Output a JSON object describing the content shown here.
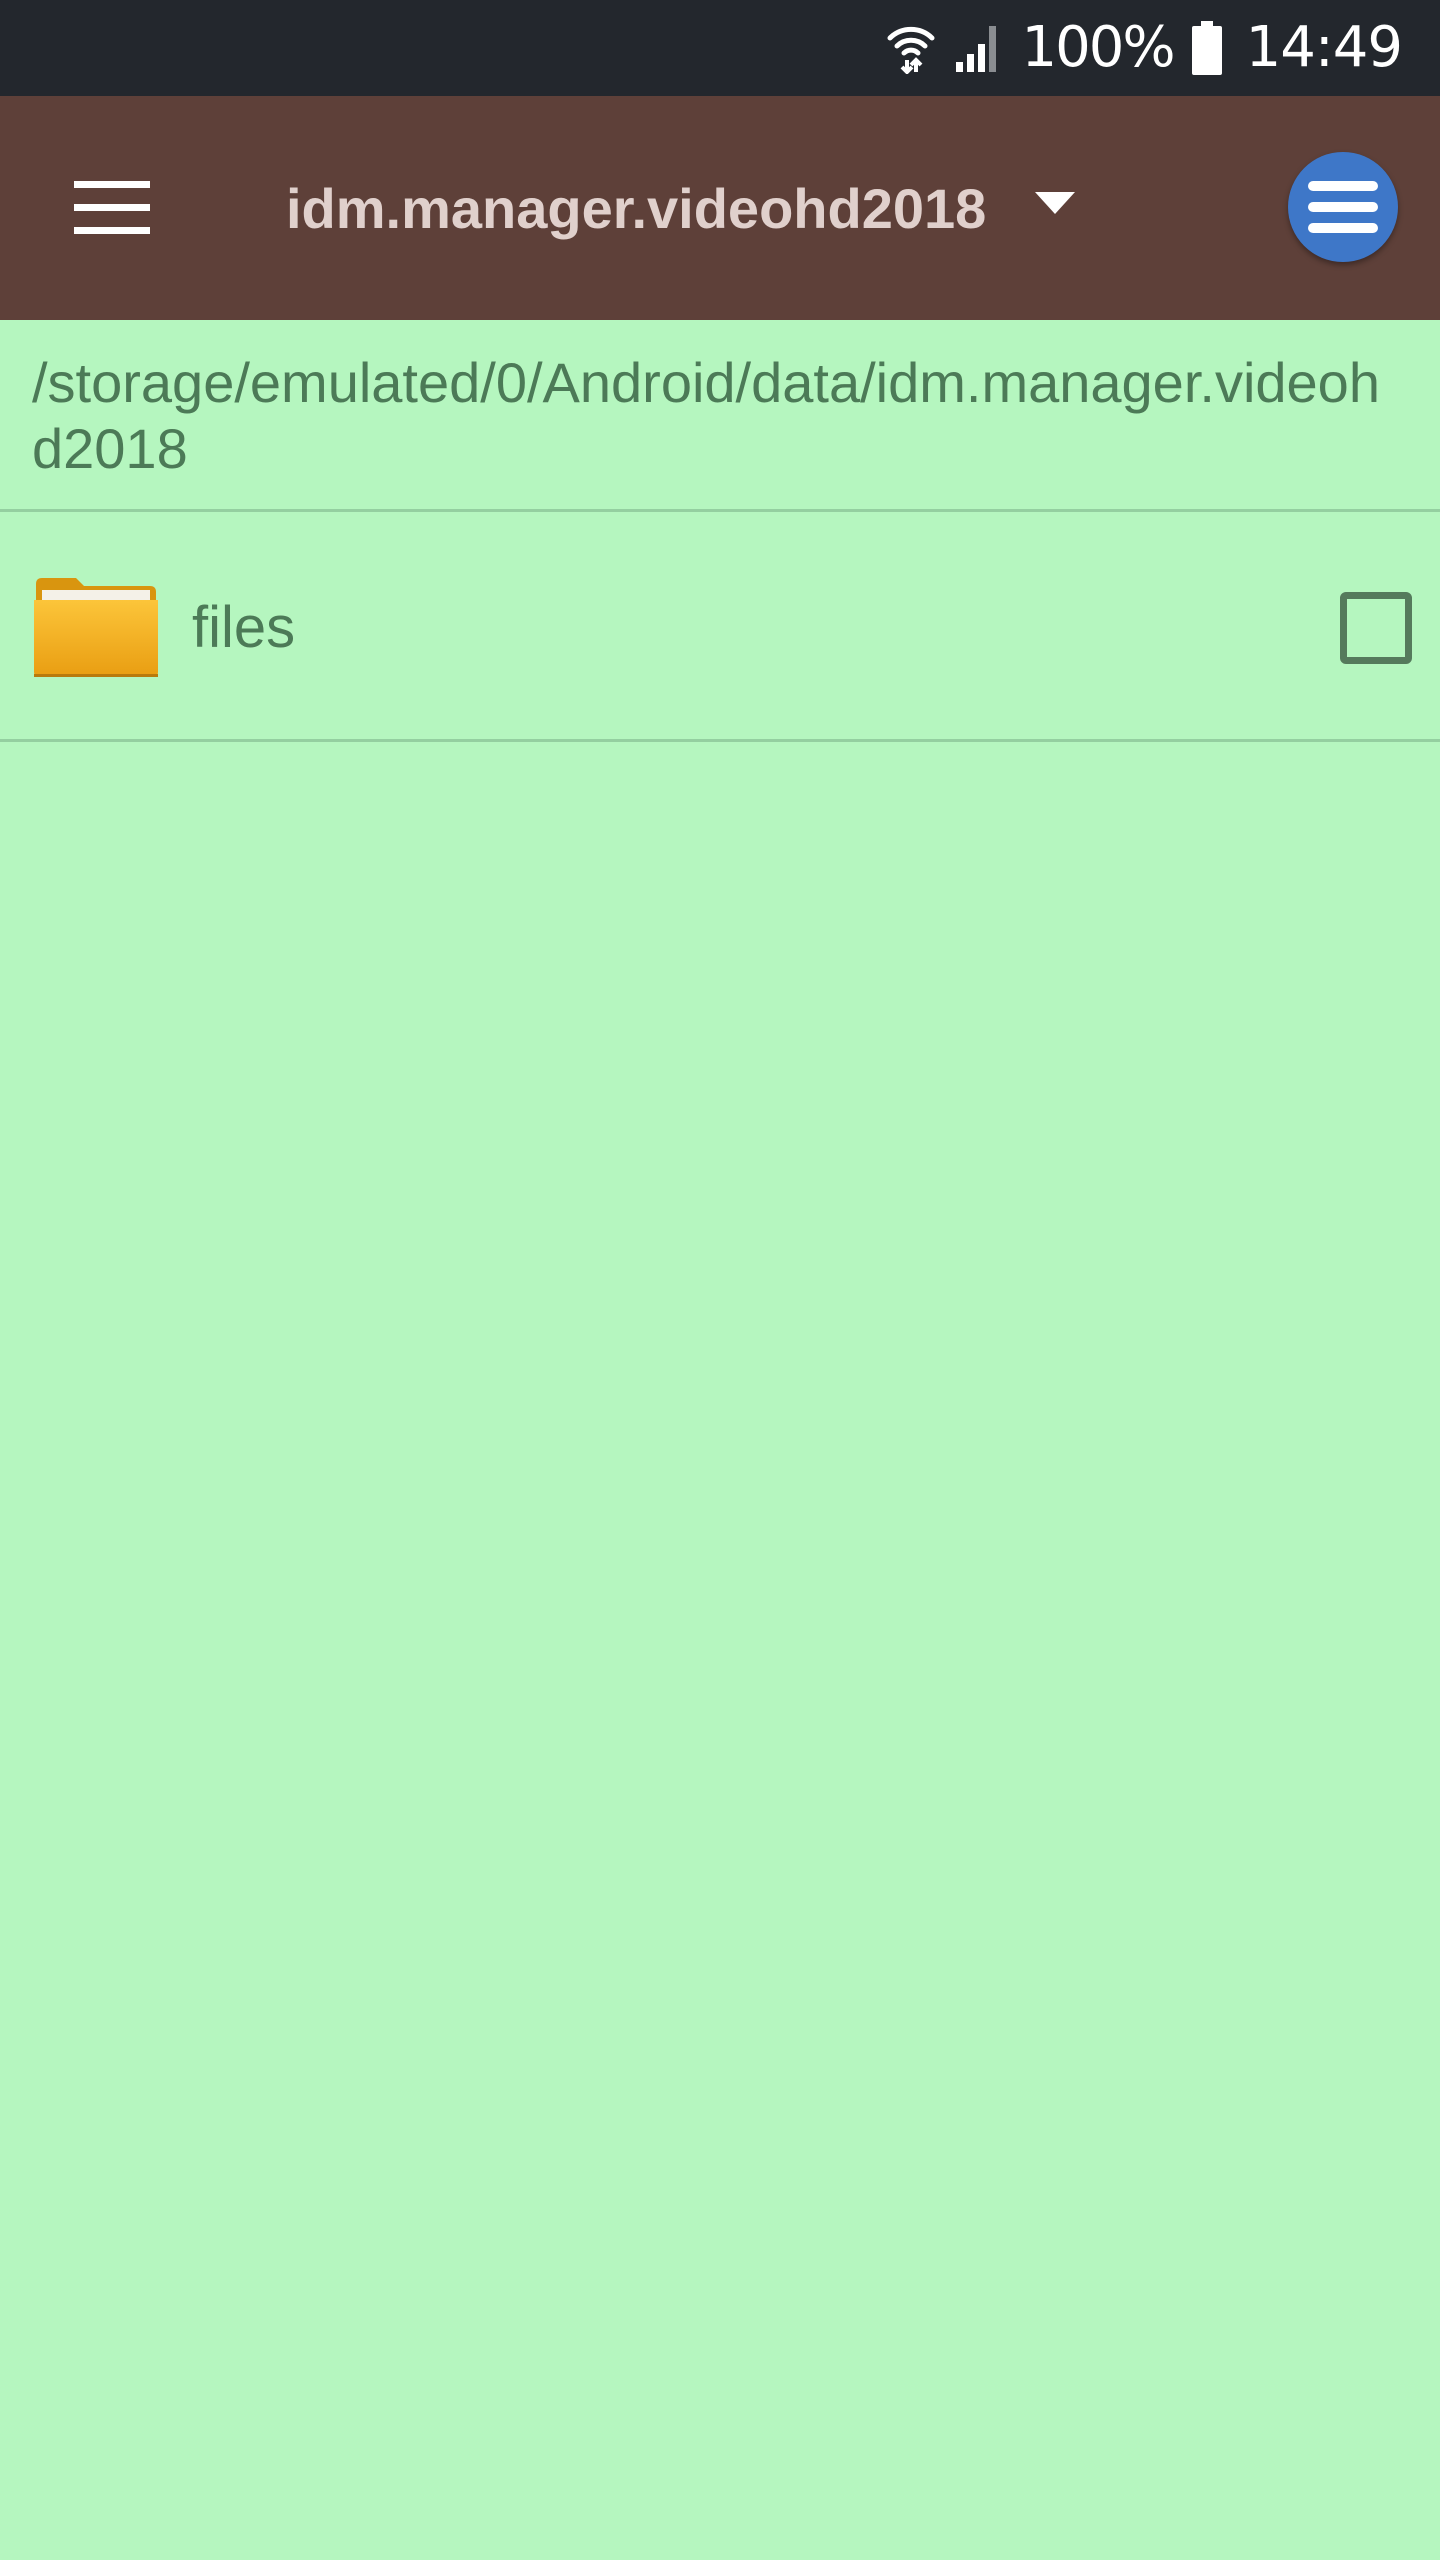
{
  "status_bar": {
    "battery_percent": "100%",
    "time": "14:49",
    "icons": [
      "wifi-icon",
      "cellular-signal-icon",
      "battery-icon"
    ]
  },
  "toolbar": {
    "title": "idm.manager.videohd2018",
    "menu_icon": "hamburger-menu-icon",
    "dropdown_icon": "caret-down-icon",
    "options_icon": "list-menu-icon"
  },
  "path": {
    "text": "/storage/emulated/0/Android/data/idm.manager.videohd2018"
  },
  "files": [
    {
      "name": "files",
      "type": "folder",
      "icon": "folder-icon",
      "checked": false
    }
  ],
  "colors": {
    "status_bar_bg": "#23272d",
    "toolbar_bg": "#5e4039",
    "toolbar_title": "#e0d0cc",
    "content_bg": "#b5f6bf",
    "content_text": "#4c7a57",
    "fab_bg": "#3e77c8",
    "folder": "#f2ae1e"
  }
}
